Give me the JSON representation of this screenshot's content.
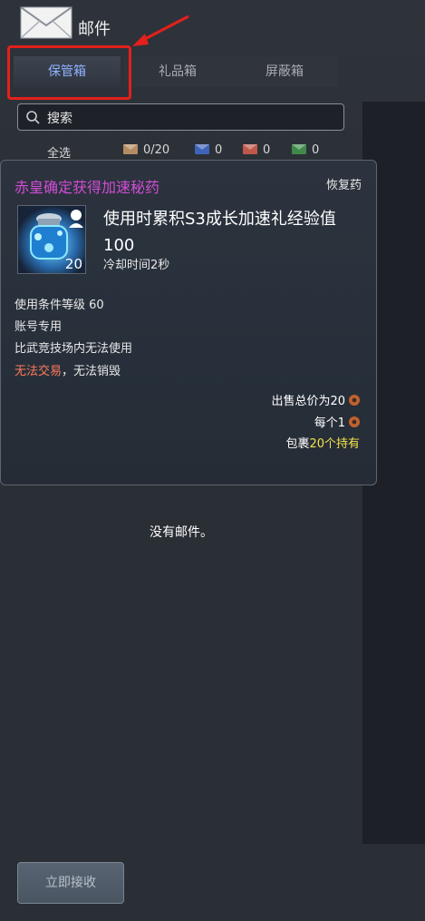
{
  "window": {
    "title": "邮件"
  },
  "tabs": [
    {
      "label": "保管箱",
      "active": true
    },
    {
      "label": "礼品箱",
      "active": false
    },
    {
      "label": "屏蔽箱",
      "active": false
    }
  ],
  "search": {
    "placeholder": "搜索"
  },
  "filters": {
    "select_all": "全选",
    "counts": [
      {
        "color": "#b58b63",
        "label": "0/20"
      },
      {
        "color": "#3e63b8",
        "label": "0"
      },
      {
        "color": "#c0584a",
        "label": "0"
      },
      {
        "color": "#3f8a4a",
        "label": "0"
      }
    ]
  },
  "tooltip": {
    "item_name": "赤皇确定获得加速秘药",
    "category": "恢复药",
    "description": "使用时累积S3成长加速礼经验值100",
    "stack_count": "20",
    "cooldown": "冷却时间2秒",
    "requirement": "使用条件等级 60",
    "account_bound": "账号专用",
    "restriction": "比武竞技场内无法使用",
    "no_trade": "无法交易",
    "no_destroy": "，无法销毁",
    "sell_total": "出售总价为20",
    "sell_each": "每个1",
    "inventory_prefix": "包裹",
    "inventory_count": "20个持有",
    "name_color": "#d24cd6",
    "warn_color": "#ff7a5c",
    "highlight_color": "#f3e24a"
  },
  "main": {
    "empty_message": "没有邮件。"
  },
  "footer": {
    "receive_label": "立即接收"
  }
}
